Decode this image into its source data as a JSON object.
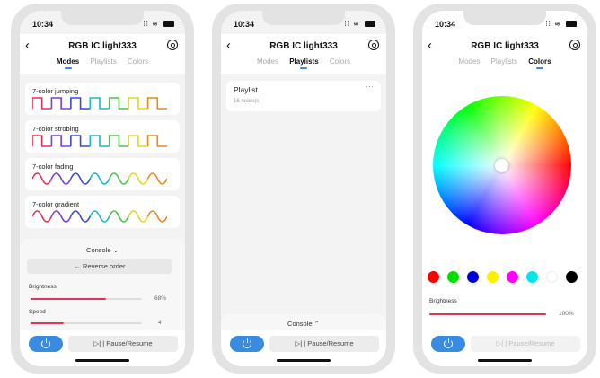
{
  "time": "10:34",
  "device_title": "RGB IC light333",
  "tabs": [
    "Modes",
    "Playlists",
    "Colors"
  ],
  "modes": [
    {
      "label": "7-color jumping",
      "pattern": "square"
    },
    {
      "label": "7-color strobing",
      "pattern": "square"
    },
    {
      "label": "7-color fading",
      "pattern": "wave"
    },
    {
      "label": "7-color gradient",
      "pattern": "wave"
    }
  ],
  "console": {
    "label_open": "Console ⌄",
    "label_closed": "Console ⌃",
    "reverse_label": "← Reverse order",
    "brightness_label": "Brightness",
    "brightness_value_text": "68%",
    "brightness_fraction": 0.68,
    "speed_label": "Speed",
    "speed_value_text": "4",
    "speed_fraction": 0.3
  },
  "playlist": {
    "title": "Playlist",
    "subtitle": "16 mode(s)",
    "more": "···"
  },
  "colors_screen": {
    "brightness_label": "Brightness",
    "brightness_value_text": "100%",
    "brightness_fraction": 1.0,
    "swatches": [
      "#ff0000",
      "#00e000",
      "#0000dd",
      "#ffee00",
      "#ff00ff",
      "#00e5ee",
      "#ffffff",
      "#000000"
    ]
  },
  "pause_label": "▷| |   Pause/Resume",
  "icons": {
    "back": "chevron-left-icon",
    "settings": "gear-icon",
    "power": "power-icon",
    "more": "more-icon"
  },
  "colors": {
    "accent": "#3a8ae0",
    "slider": "#e0345a",
    "wave": [
      "#e0345a",
      "#7b3fe0",
      "#3a4ad8",
      "#19b8c8",
      "#45c84a",
      "#e6d81a",
      "#e88a1a"
    ]
  }
}
